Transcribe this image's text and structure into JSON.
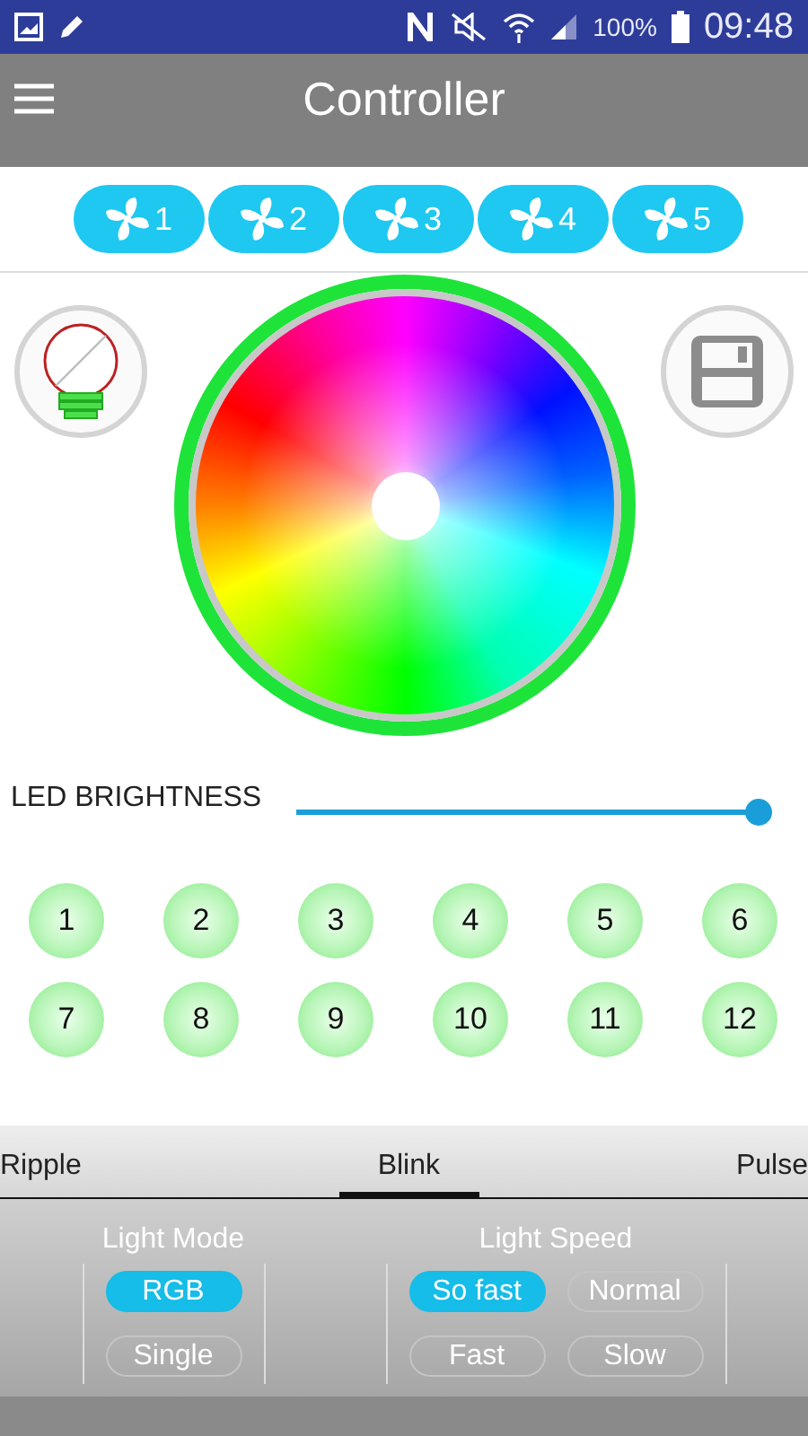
{
  "status_bar": {
    "battery": "100%",
    "time": "09:48"
  },
  "app_bar": {
    "title": "Controller"
  },
  "fans": [
    {
      "label": "1"
    },
    {
      "label": "2"
    },
    {
      "label": "3"
    },
    {
      "label": "4"
    },
    {
      "label": "5"
    }
  ],
  "brightness": {
    "label": "LED BRIGHTNESS",
    "level": 1
  },
  "zones": [
    {
      "label": "1"
    },
    {
      "label": "2"
    },
    {
      "label": "3"
    },
    {
      "label": "4"
    },
    {
      "label": "5"
    },
    {
      "label": "6"
    },
    {
      "label": "7"
    },
    {
      "label": "8"
    },
    {
      "label": "9"
    },
    {
      "label": "10"
    },
    {
      "label": "11"
    },
    {
      "label": "12"
    }
  ],
  "tabs": [
    {
      "label": "Ripple",
      "selected": false
    },
    {
      "label": "Blink",
      "selected": true
    },
    {
      "label": "Pulse",
      "selected": false
    }
  ],
  "light_mode": {
    "title": "Light Mode",
    "options": [
      {
        "label": "RGB",
        "selected": true
      },
      {
        "label": "Single",
        "selected": false
      }
    ]
  },
  "light_speed": {
    "title": "Light Speed",
    "options": [
      {
        "label": "So fast",
        "selected": true
      },
      {
        "label": "Normal",
        "selected": false
      },
      {
        "label": "Fast",
        "selected": false
      },
      {
        "label": "Slow",
        "selected": false
      }
    ]
  }
}
